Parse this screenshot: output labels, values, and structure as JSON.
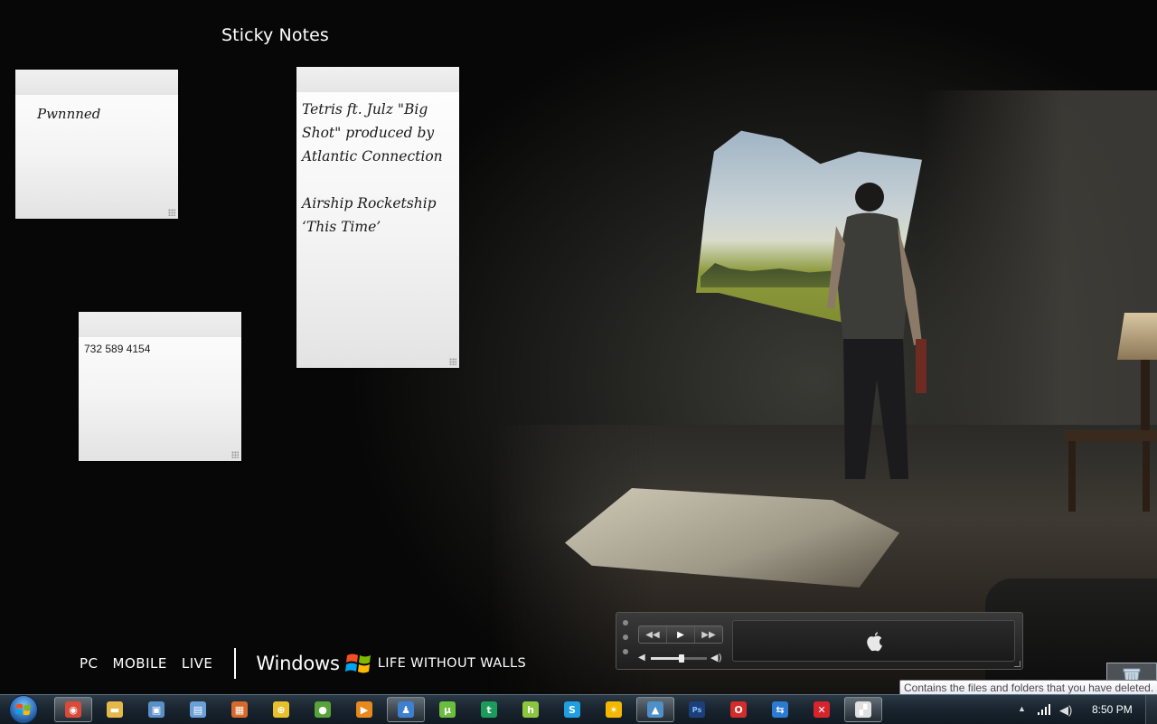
{
  "gadget_title": "Sticky Notes",
  "notes": [
    {
      "text": "Pwnnned"
    },
    {
      "text": "Tetris ft. Julz \"Big\nShot\" produced by\nAtlantic Connection\n\nAirship Rocketship\n‘This Time’"
    },
    {
      "text": "732 589 4154"
    }
  ],
  "branding": {
    "links": [
      "PC",
      "MOBILE",
      "LIVE"
    ],
    "windows": "Windows",
    "tagline": "LIFE WITHOUT WALLS"
  },
  "media_gadget": {
    "volume_level": 0.55,
    "screen_icon": "apple-icon"
  },
  "tooltip": "Contains the files and folders that you have deleted.",
  "taskbar": {
    "apps": [
      {
        "name": "chrome",
        "icon": "chrome-icon",
        "color": "#d94a38",
        "glyph": "◉",
        "active": true
      },
      {
        "name": "explorer",
        "icon": "folder-icon",
        "color": "#e6b84a",
        "glyph": "▬",
        "active": false
      },
      {
        "name": "control-panel",
        "icon": "control-panel-icon",
        "color": "#5a8fc9",
        "glyph": "▣",
        "active": false
      },
      {
        "name": "network",
        "icon": "network-icon",
        "color": "#6aa0d8",
        "glyph": "▤",
        "active": false
      },
      {
        "name": "media-center",
        "icon": "media-center-icon",
        "color": "#d66a2a",
        "glyph": "▦",
        "active": false
      },
      {
        "name": "browser",
        "icon": "globe-icon",
        "color": "#e8c02c",
        "glyph": "⊕",
        "active": false
      },
      {
        "name": "games",
        "icon": "games-icon",
        "color": "#58a23a",
        "glyph": "●",
        "active": false
      },
      {
        "name": "media-player",
        "icon": "media-player-icon",
        "color": "#e8891d",
        "glyph": "▶",
        "active": false
      },
      {
        "name": "wlm",
        "icon": "messenger-icon",
        "color": "#3f7fcf",
        "glyph": "♟",
        "active": true
      },
      {
        "name": "utorrent",
        "icon": "utorrent-icon",
        "color": "#6bbd3e",
        "glyph": "µ",
        "active": false
      },
      {
        "name": "trillian",
        "icon": "trillian-icon",
        "color": "#1c9c5a",
        "glyph": "t",
        "active": false
      },
      {
        "name": "hulu",
        "icon": "hulu-icon",
        "color": "#8cc63f",
        "glyph": "h",
        "active": false
      },
      {
        "name": "skype",
        "icon": "skype-icon",
        "color": "#1f9ee0",
        "glyph": "S",
        "active": false
      },
      {
        "name": "aim",
        "icon": "aim-icon",
        "color": "#f5b800",
        "glyph": "✶",
        "active": false
      },
      {
        "name": "photo-gallery",
        "icon": "photo-gallery-icon",
        "color": "#4f8fc7",
        "glyph": "▲",
        "active": true
      },
      {
        "name": "photoshop",
        "icon": "photoshop-icon",
        "color": "#1c3f7a",
        "glyph": "Ps",
        "active": false
      },
      {
        "name": "opera",
        "icon": "opera-icon",
        "color": "#d42b2b",
        "glyph": "O",
        "active": false
      },
      {
        "name": "teamviewer",
        "icon": "teamviewer-icon",
        "color": "#2b7bd1",
        "glyph": "⇆",
        "active": false
      },
      {
        "name": "xmarks",
        "icon": "x-icon",
        "color": "#d6242c",
        "glyph": "✕",
        "active": false
      },
      {
        "name": "windows-live",
        "icon": "windows-live-icon",
        "color": "#e0e0e0",
        "glyph": "▞",
        "active": true
      }
    ],
    "clock": "8:50 PM"
  }
}
